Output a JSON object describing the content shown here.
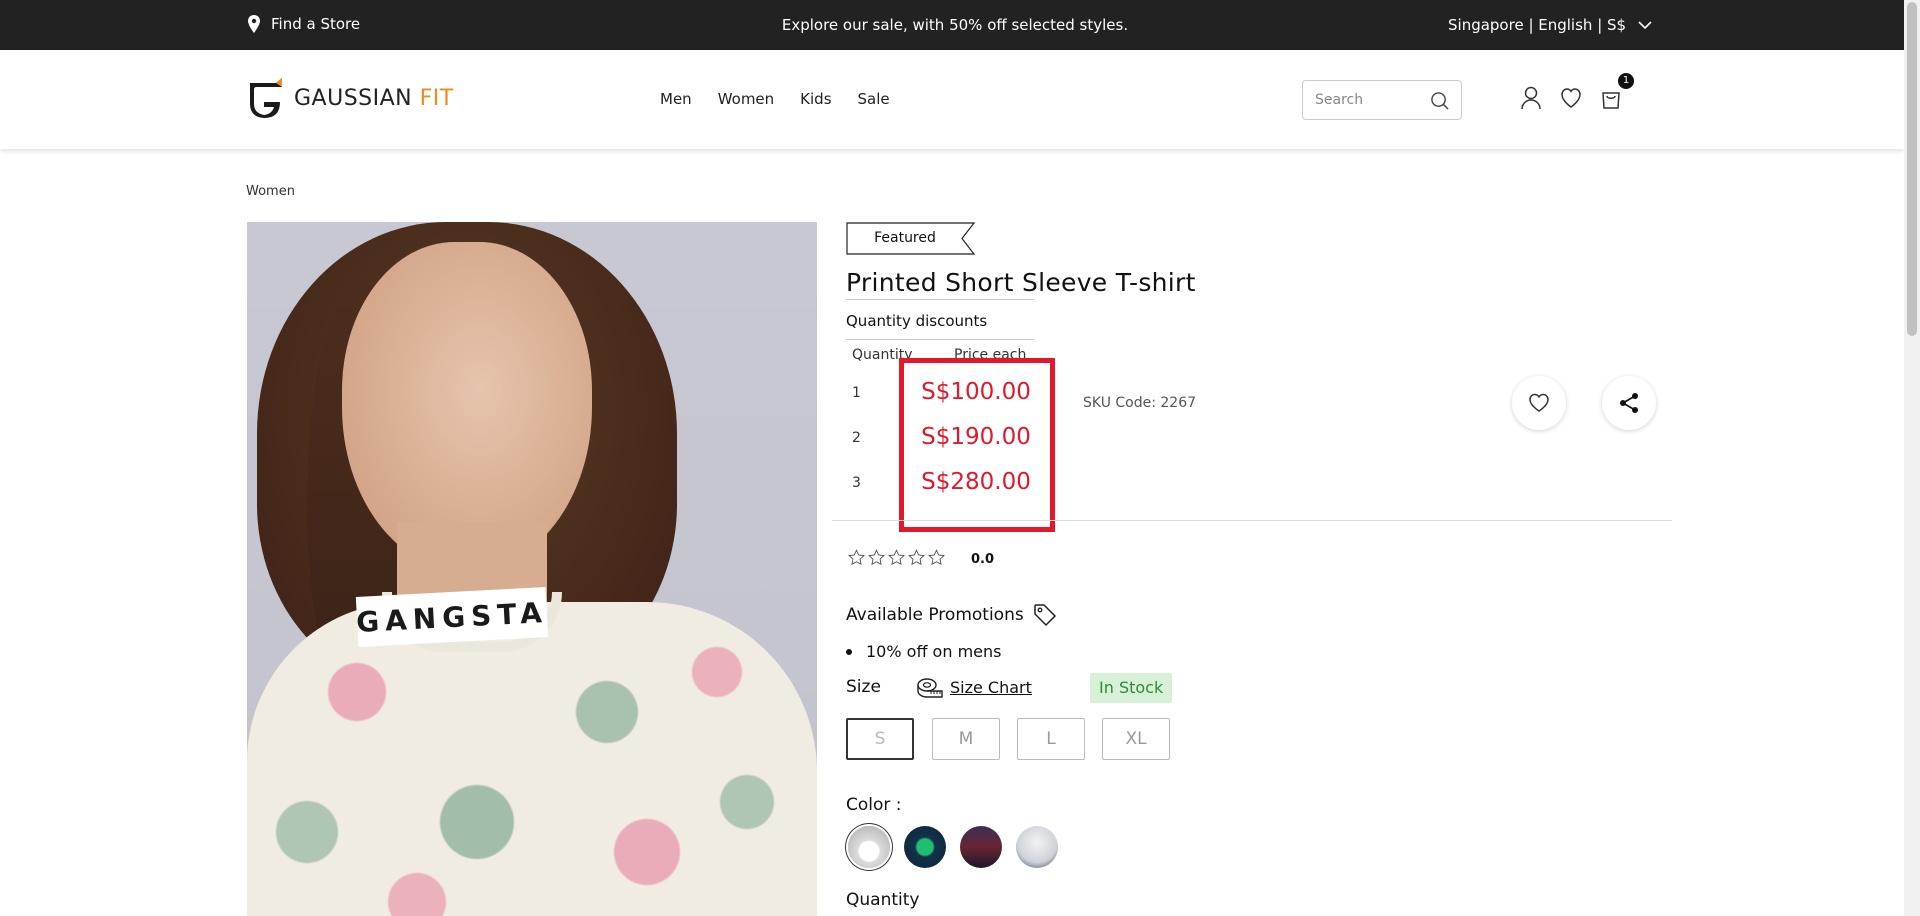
{
  "topbar": {
    "find_store": "Find a Store",
    "promo": "Explore our sale, with 50% off selected styles.",
    "locale": "Singapore | English | S$"
  },
  "header": {
    "logo_main": "GAUSSIAN",
    "logo_accent": "FIT",
    "nav": [
      "Men",
      "Women",
      "Kids",
      "Sale"
    ],
    "search_placeholder": "Search",
    "cart_count": "1"
  },
  "breadcrumb": "Women",
  "product": {
    "badge": "Featured",
    "title": "Printed Short Sleeve T-shirt",
    "image_print_text": "GANGSTA",
    "quantity_discounts": {
      "title": "Quantity discounts",
      "col_quantity": "Quantity",
      "col_price": "Price each",
      "rows": [
        {
          "qty": "1",
          "price": "S$100.00"
        },
        {
          "qty": "2",
          "price": "S$190.00"
        },
        {
          "qty": "3",
          "price": "S$280.00"
        }
      ]
    },
    "sku": "SKU Code: 2267",
    "rating": "0.0",
    "rating_stars": 0,
    "promotions_title": "Available Promotions",
    "promotions": [
      "10% off on mens"
    ],
    "size_label": "Size",
    "size_chart": "Size Chart",
    "stock_status": "In Stock",
    "sizes": [
      "S",
      "M",
      "L",
      "XL"
    ],
    "selected_size": "S",
    "color_label": "Color :",
    "colors": [
      "white-graphic",
      "navy-green",
      "purple-print",
      "grey-marl"
    ],
    "quantity_label": "Quantity"
  },
  "colors": {
    "topbar_bg": "#222222",
    "accent": "#f08a1c",
    "highlight": "#e3182a",
    "stock_bg": "#d6f1d6",
    "stock_text": "#2e8b3a"
  }
}
